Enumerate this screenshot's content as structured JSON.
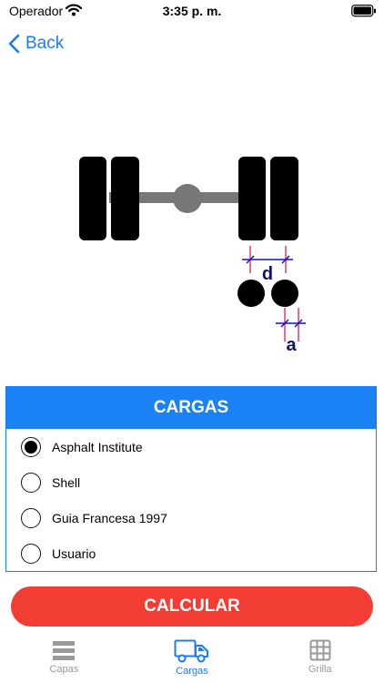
{
  "status_bar": {
    "carrier": "Operador",
    "time": "3:35 p. m."
  },
  "nav": {
    "back_label": "Back"
  },
  "diagram": {
    "label_d": "d",
    "label_a": "a"
  },
  "panel": {
    "title": "CARGAS",
    "options": [
      {
        "label": "Asphalt Institute",
        "selected": true
      },
      {
        "label": "Shell",
        "selected": false
      },
      {
        "label": "Guia Francesa 1997",
        "selected": false
      },
      {
        "label": "Usuario",
        "selected": false
      }
    ]
  },
  "calculate_label": "CALCULAR",
  "tabs": [
    {
      "label": "Capas",
      "icon": "layers-icon",
      "active": false
    },
    {
      "label": "Cargas",
      "icon": "truck-icon",
      "active": true
    },
    {
      "label": "Grilla",
      "icon": "grid-icon",
      "active": false
    }
  ],
  "colors": {
    "accent": "#1a7cf0",
    "header": "#1a82f4",
    "button": "#f23d35",
    "tab_inactive": "#999999"
  }
}
